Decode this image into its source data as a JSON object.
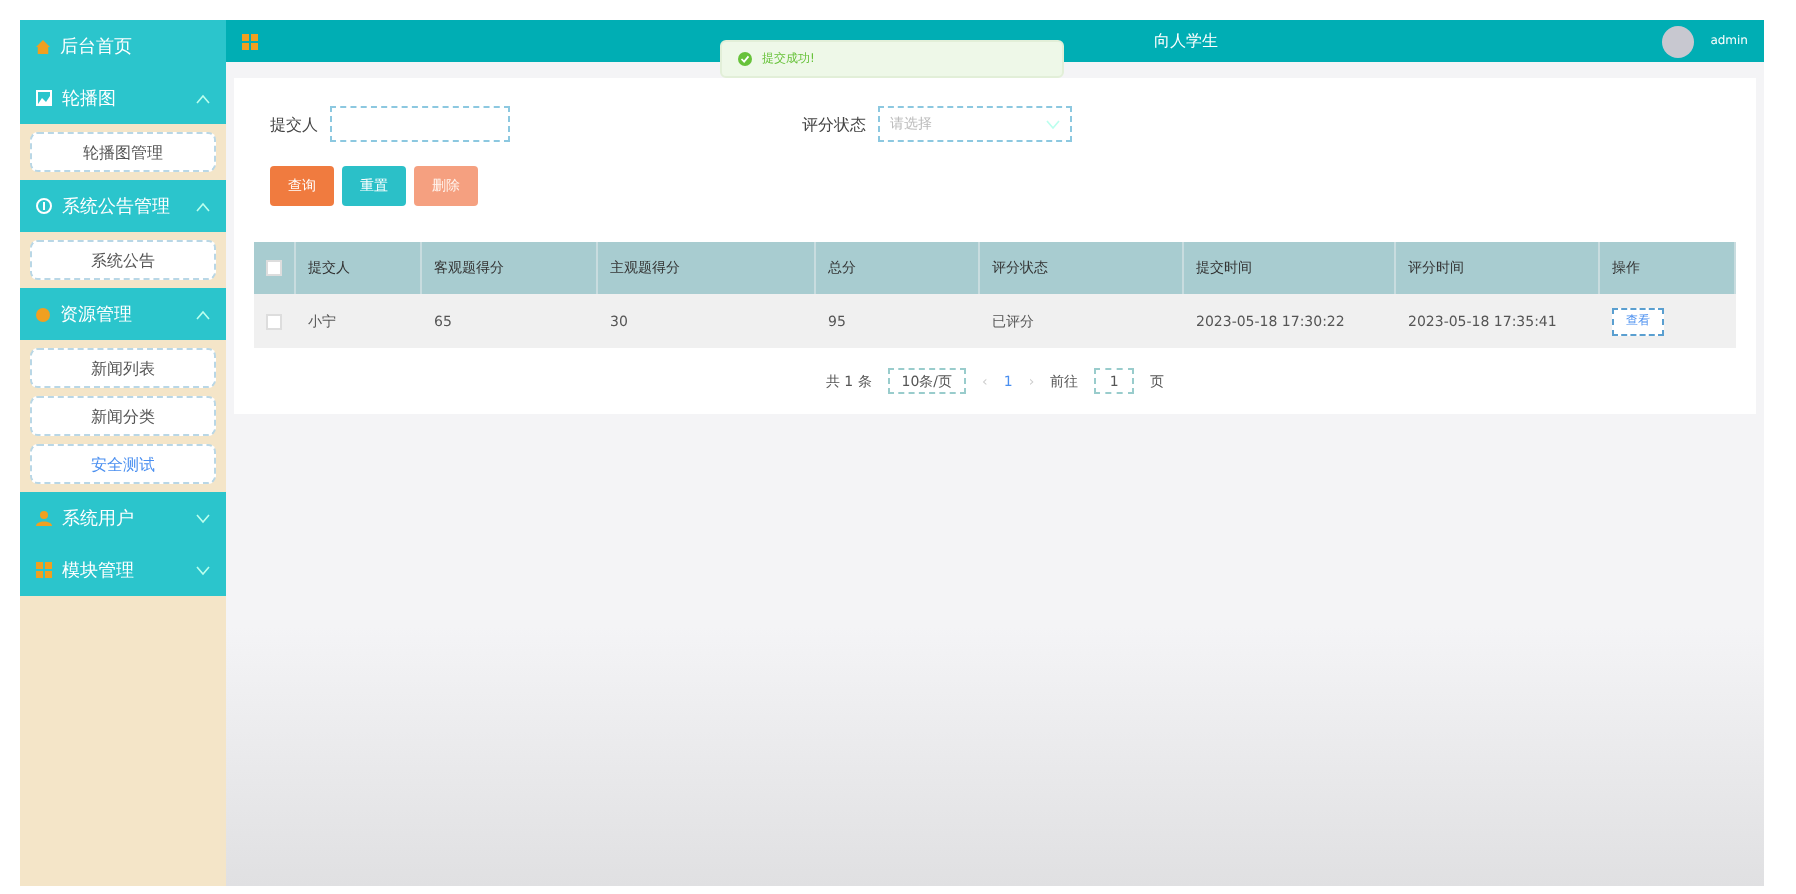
{
  "sidebar": {
    "items": [
      {
        "kind": "link",
        "label": "后台首页"
      },
      {
        "kind": "group",
        "label": "轮播图",
        "expanded": true,
        "children": [
          {
            "label": "轮播图管理",
            "selected": false
          }
        ]
      },
      {
        "kind": "group",
        "label": "系统公告管理",
        "expanded": true,
        "children": [
          {
            "label": "系统公告",
            "selected": false
          }
        ]
      },
      {
        "kind": "group",
        "label": "资源管理",
        "expanded": true,
        "children": [
          {
            "label": "新闻列表",
            "selected": false
          },
          {
            "label": "新闻分类",
            "selected": false
          },
          {
            "label": "安全测试",
            "selected": true
          }
        ]
      },
      {
        "kind": "group",
        "label": "系统用户",
        "expanded": false
      },
      {
        "kind": "group",
        "label": "模块管理",
        "expanded": false
      }
    ]
  },
  "header": {
    "title": "向人学生",
    "user": "admin"
  },
  "toast": {
    "message": "提交成功!"
  },
  "filters": [
    {
      "kind": "input",
      "label": "提交人"
    },
    {
      "kind": "select",
      "label": "评分状态",
      "placeholder": "请选择"
    }
  ],
  "buttons": [
    {
      "label": "查询",
      "color": "#f07b3f",
      "disabled": false
    },
    {
      "label": "重置",
      "color": "#2bc0c8",
      "disabled": false
    },
    {
      "label": "删除",
      "color": "#f5a080",
      "disabled": true
    }
  ],
  "table": {
    "all_checked": false,
    "columns": [
      "提交人",
      "客观题得分",
      "主观题得分",
      "总分",
      "评分状态",
      "提交时间",
      "评分时间",
      "操作"
    ],
    "rows": [
      {
        "checked": false,
        "cells": [
          "小宁",
          "65",
          "30",
          "95",
          "已评分",
          "2023-05-18 17:30:22",
          "2023-05-18 17:35:41"
        ],
        "action": "查看"
      }
    ]
  },
  "pagination": {
    "total": "共 1 条",
    "page_size": "10条/页",
    "prev": "‹",
    "current": "1",
    "next": "›",
    "goto_label": "前往",
    "goto_value": "1",
    "goto_suffix": "页"
  }
}
